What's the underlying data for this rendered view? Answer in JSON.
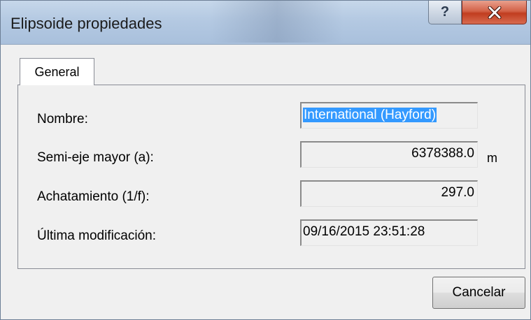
{
  "window": {
    "title": "Elipsoide propiedades",
    "help_label": "?"
  },
  "tabs": [
    {
      "label": "General"
    }
  ],
  "form": {
    "nombre": {
      "label": "Nombre:",
      "value": "International (Hayford)"
    },
    "semi_eje": {
      "label": "Semi-eje mayor (a):",
      "value": "6378388.0",
      "unit": "m"
    },
    "achatamiento": {
      "label": "Achatamiento (1/f):",
      "value": "297.0"
    },
    "ultima_modificacion": {
      "label": "Última modificación:",
      "value": "09/16/2015 23:51:28"
    }
  },
  "buttons": {
    "cancel_label": "Cancelar"
  },
  "icons": {
    "help": "help-icon",
    "close": "close-icon"
  },
  "colors": {
    "selection": "#3399ff",
    "close_button": "#c13d20",
    "titlebar": "#b4c9e2"
  }
}
